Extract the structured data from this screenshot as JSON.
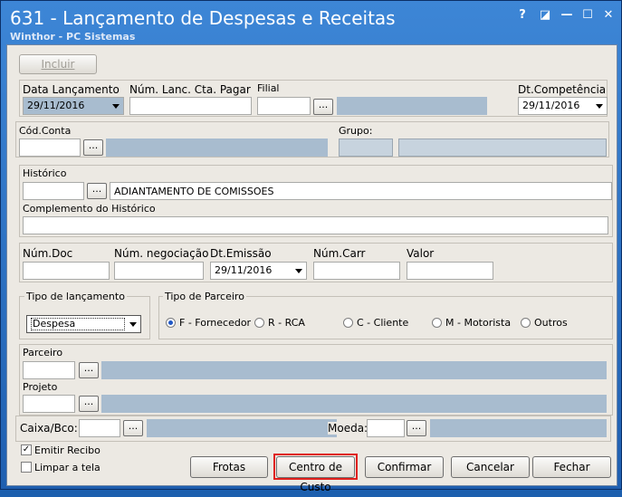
{
  "window": {
    "title": "631 - Lançamento de Despesas e Receitas",
    "subtitle": "Winthor - PC Sistemas",
    "help_glyph": "?",
    "restore_glyph": "◪",
    "minimize_glyph": "—",
    "maximize_glyph": "☐",
    "close_glyph": "✕"
  },
  "toolbar": {
    "incluir_label": "Incluir"
  },
  "header": {
    "data_lancamento_label": "Data Lançamento",
    "data_lancamento_value": "29/11/2016",
    "num_lanc_label": "Núm. Lanc. Cta. Pagar",
    "num_lanc_value": "",
    "filial_label": "Filial",
    "filial_value": "",
    "dt_competencia_label": "Dt.Competência",
    "dt_competencia_value": "29/11/2016"
  },
  "conta": {
    "cod_conta_label": "Cód.Conta",
    "cod_conta_value": "",
    "grupo_label": "Grupo:"
  },
  "historico": {
    "historico_label": "Histórico",
    "historico_code": "",
    "historico_text": "ADIANTAMENTO DE COMISSOES",
    "complemento_label": "Complemento do Histórico",
    "complemento_value": ""
  },
  "docs": {
    "num_doc_label": "Núm.Doc",
    "num_negociacao_label": "Núm. negociação",
    "dt_emissao_label": "Dt.Emissão",
    "dt_emissao_value": "29/11/2016",
    "num_carr_label": "Núm.Carr",
    "valor_label": "Valor"
  },
  "tipo_lancamento": {
    "label": "Tipo de lançamento",
    "selected": "Despesa"
  },
  "tipo_parceiro": {
    "label": "Tipo de Parceiro",
    "options": [
      "F - Fornecedor",
      "R - RCA",
      "C - Cliente",
      "M - Motorista",
      "Outros"
    ],
    "selected_index": 0
  },
  "parceiro": {
    "parceiro_label": "Parceiro",
    "projeto_label": "Projeto"
  },
  "caixa": {
    "caixa_label": "Caixa/Bco:",
    "moeda_label": "Moeda:"
  },
  "options": {
    "emitir_recibo_label": "Emitir Recibo",
    "emitir_recibo_checked": true,
    "limpar_tela_label": "Limpar a tela",
    "limpar_tela_checked": false
  },
  "buttons": {
    "frotas": "Frotas",
    "centro_custo": "Centro de Custo",
    "confirmar": "Confirmar",
    "cancelar": "Cancelar",
    "fechar": "Fechar"
  },
  "ellipsis": "...",
  "colors": {
    "title_bar": "#1f5fb0",
    "highlight": "#e0201d",
    "readonly_field": "#a8bccf"
  }
}
